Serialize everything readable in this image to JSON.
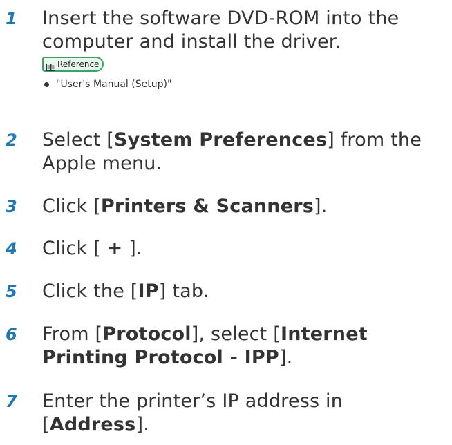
{
  "steps": [
    {
      "number": "1",
      "parts": [
        {
          "text": "Insert the software DVD-ROM into the computer and install the driver.",
          "bold": false
        }
      ]
    },
    {
      "number": "2",
      "parts": [
        {
          "text": "Select [",
          "bold": false
        },
        {
          "text": "System Preferences",
          "bold": true
        },
        {
          "text": "] from the Apple menu.",
          "bold": false
        }
      ]
    },
    {
      "number": "3",
      "parts": [
        {
          "text": "Click [",
          "bold": false
        },
        {
          "text": "Printers & Scanners",
          "bold": true
        },
        {
          "text": "].",
          "bold": false
        }
      ]
    },
    {
      "number": "4",
      "parts": [
        {
          "text": "Click [ ",
          "bold": false
        },
        {
          "text": "+",
          "bold": true
        },
        {
          "text": " ].",
          "bold": false
        }
      ]
    },
    {
      "number": "5",
      "parts": [
        {
          "text": "Click the [",
          "bold": false
        },
        {
          "text": "IP",
          "bold": true
        },
        {
          "text": "] tab.",
          "bold": false
        }
      ]
    },
    {
      "number": "6",
      "parts": [
        {
          "text": "From [",
          "bold": false
        },
        {
          "text": "Protocol",
          "bold": true
        },
        {
          "text": "], select [",
          "bold": false
        },
        {
          "text": "Internet Printing Protocol - IPP",
          "bold": true
        },
        {
          "text": "].",
          "bold": false
        }
      ]
    },
    {
      "number": "7",
      "parts": [
        {
          "text": "Enter the printer’s IP address in [",
          "bold": false
        },
        {
          "text": "Address",
          "bold": true
        },
        {
          "text": "].",
          "bold": false
        }
      ]
    }
  ],
  "reference": {
    "label": "Reference",
    "icon": "book-icon",
    "items": [
      "\"User's Manual (Setup)\""
    ]
  },
  "colors": {
    "step_number": "#1f78b4",
    "text": "#333333",
    "reference_border": "#3aa36b",
    "reference_bg": "#e9f6ee"
  }
}
